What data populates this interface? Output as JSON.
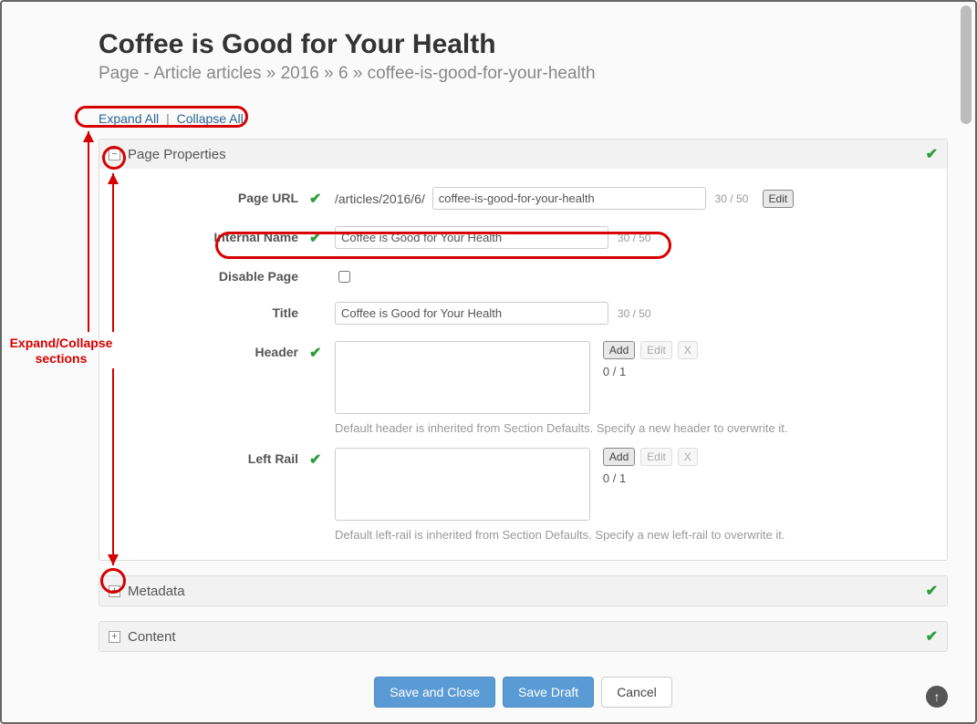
{
  "header": {
    "title": "Coffee is Good for Your Health",
    "breadcrumb": "Page - Article  articles » 2016 » 6 » coffee-is-good-for-your-health"
  },
  "expandCollapse": {
    "expand": "Expand All",
    "collapse": "Collapse All"
  },
  "annotations": {
    "expandCollapseSections": "Expand/Collapse\nsections"
  },
  "sections": {
    "pageProperties": {
      "title": "Page Properties",
      "toggle": "−",
      "fields": {
        "pageUrl": {
          "label": "Page URL",
          "prefix": "/articles/2016/6/",
          "value": "coffee-is-good-for-your-health",
          "counter": "30 / 50",
          "editBtn": "Edit"
        },
        "internalName": {
          "label": "Internal Name",
          "value": "Coffee is Good for Your Health",
          "counter": "30 / 50"
        },
        "disablePage": {
          "label": "Disable Page"
        },
        "titleField": {
          "label": "Title",
          "value": "Coffee is Good for Your Health",
          "counter": "30 / 50"
        },
        "headerArea": {
          "label": "Header",
          "addBtn": "Add",
          "editBtn": "Edit",
          "deleteBtn": "X",
          "count": "0 / 1",
          "help": "Default header is inherited from Section Defaults. Specify a new header to overwrite it."
        },
        "leftRailArea": {
          "label": "Left Rail",
          "addBtn": "Add",
          "editBtn": "Edit",
          "deleteBtn": "X",
          "count": "0 / 1",
          "help": "Default left-rail is inherited from Section Defaults. Specify a new left-rail to overwrite it."
        }
      }
    },
    "metadata": {
      "title": "Metadata",
      "toggle": "+"
    },
    "content": {
      "title": "Content",
      "toggle": "+"
    }
  },
  "footer": {
    "saveClose": "Save and Close",
    "saveDraft": "Save Draft",
    "cancel": "Cancel"
  }
}
